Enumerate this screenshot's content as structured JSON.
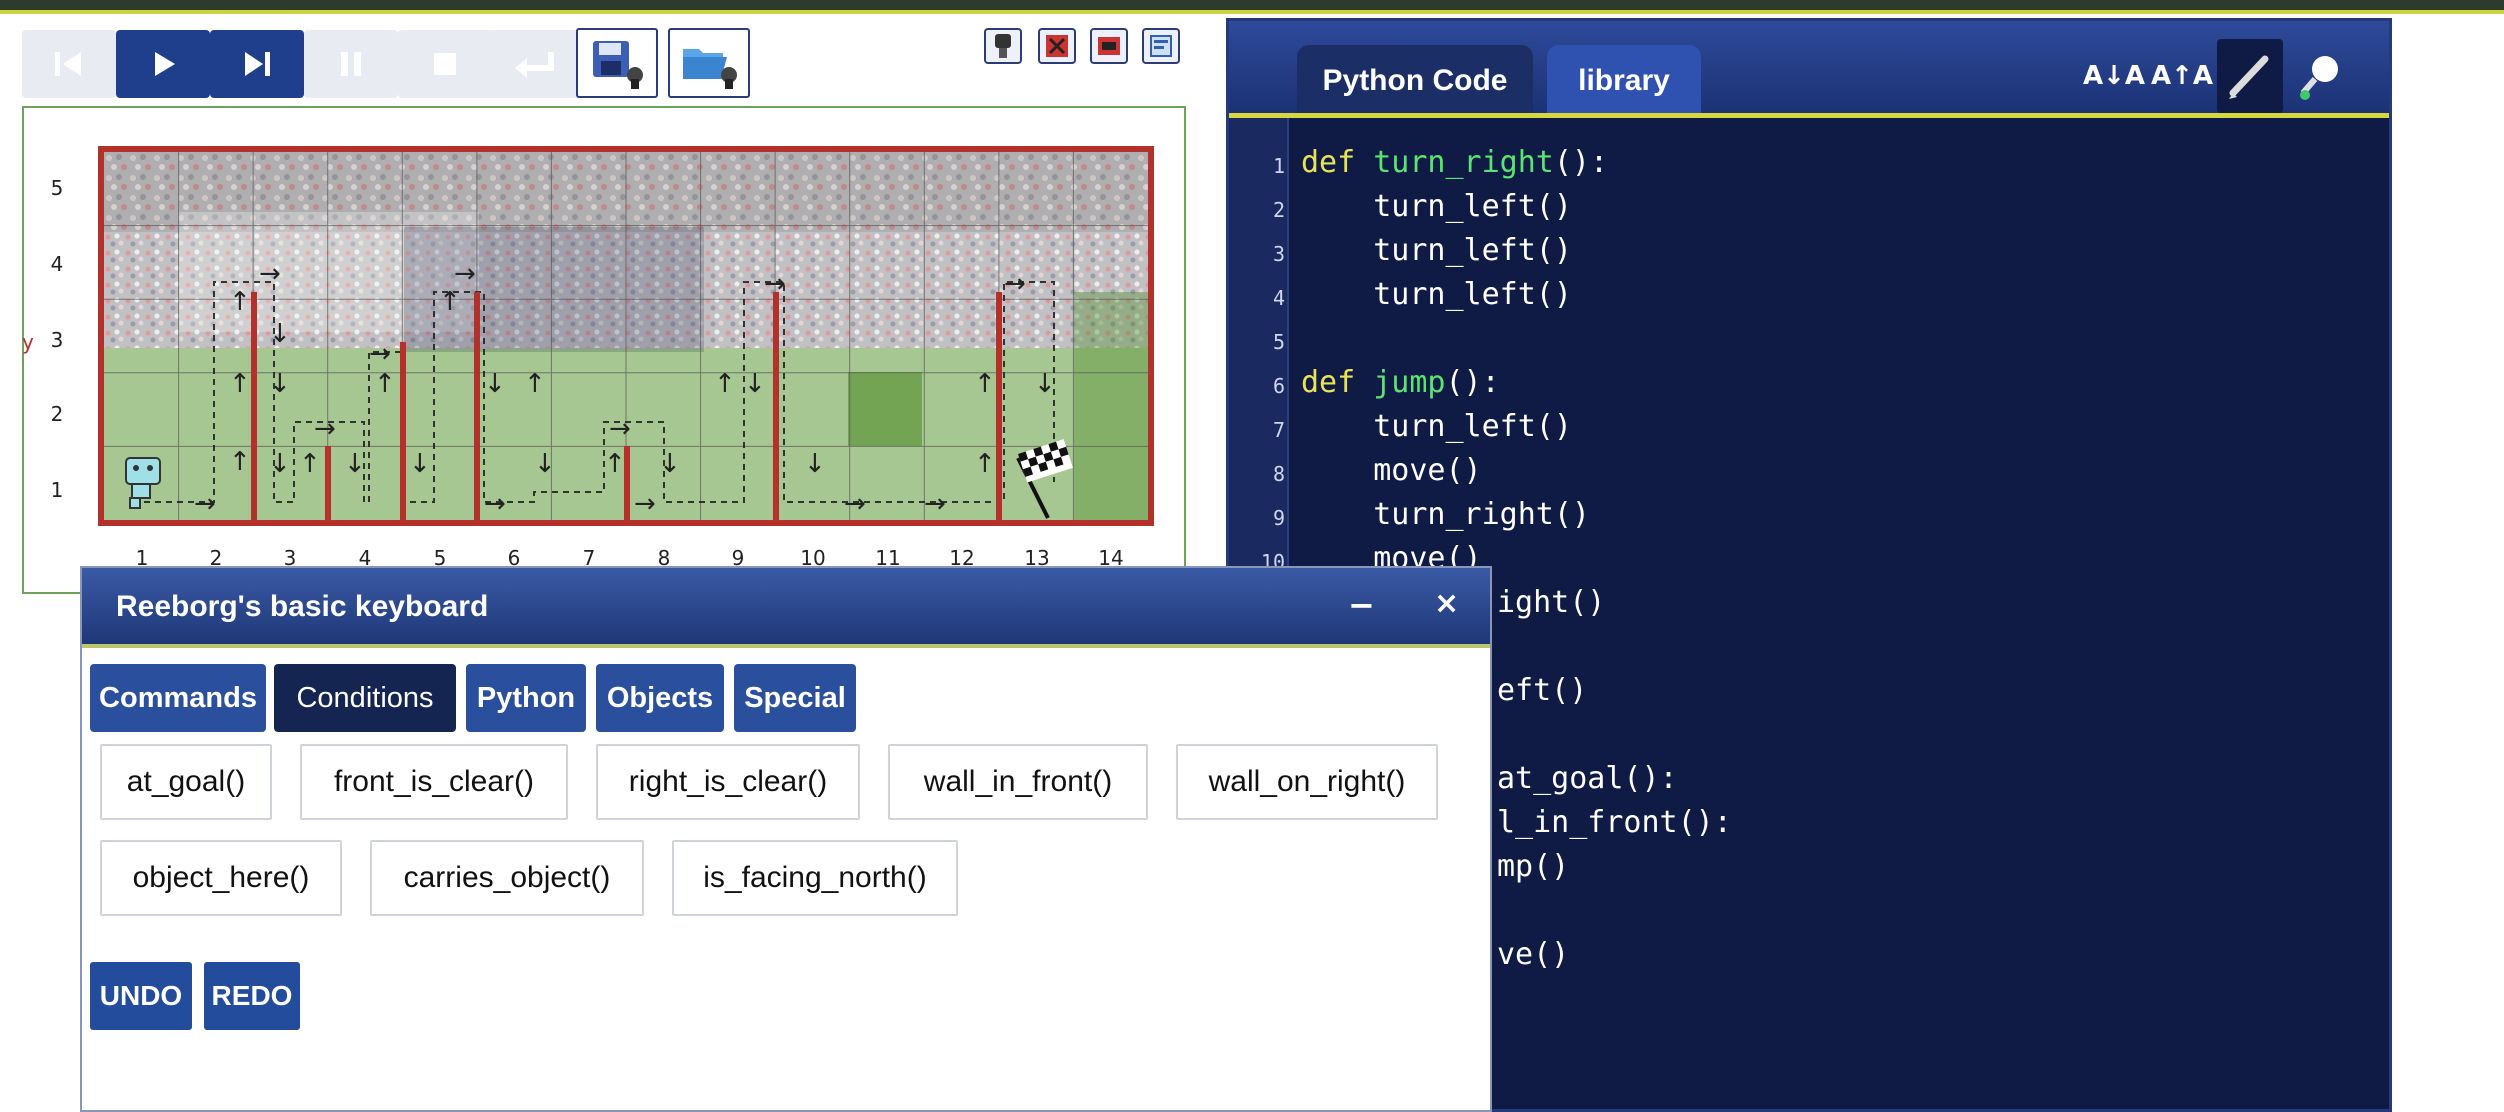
{
  "toolbar": {
    "buttons": [
      "reload",
      "run",
      "step",
      "pause",
      "stop",
      "reverse-step"
    ],
    "file_buttons": [
      "save-world",
      "open-world"
    ],
    "small_buttons": [
      "robot-icon",
      "world-edit-icon",
      "world-clear-icon",
      "world-info-icon"
    ]
  },
  "world": {
    "y_axis_label": "y",
    "y_ticks": [
      "5",
      "4",
      "3",
      "2",
      "1"
    ],
    "x_ticks": [
      "1",
      "2",
      "3",
      "4",
      "5",
      "6",
      "7",
      "8",
      "9",
      "10",
      "11",
      "12",
      "13",
      "14"
    ],
    "colors": {
      "wall": "#b3302b",
      "frame": "#6da35c"
    }
  },
  "editor": {
    "tabs": [
      "Python Code",
      "library"
    ],
    "head_icons": [
      "A↓A",
      "A↑A"
    ],
    "line_numbers": [
      "1",
      "2",
      "3",
      "4",
      "5",
      "6",
      "7",
      "8",
      "9",
      "10"
    ],
    "lines": [
      "def turn_right():",
      "    turn_left()",
      "    turn_left()",
      "    turn_left()",
      "",
      "def jump():",
      "    turn_left()",
      "    move()",
      "    turn_right()",
      "    move()"
    ],
    "partial_lines": [
      "ight()",
      "eft()",
      "at_goal():",
      "l_in_front():",
      "mp()",
      "ve()"
    ]
  },
  "keyboard": {
    "title": "Reeborg's basic keyboard",
    "minimize": "−",
    "close": "×",
    "tabs": [
      "Commands",
      "Conditions",
      "Python",
      "Objects",
      "Special"
    ],
    "active_tab": "Conditions",
    "row1": [
      "at_goal()",
      "front_is_clear()",
      "right_is_clear()",
      "wall_in_front()",
      "wall_on_right()"
    ],
    "row2": [
      "object_here()",
      "carries_object()",
      "is_facing_north()"
    ],
    "undo": "UNDO",
    "redo": "REDO"
  }
}
